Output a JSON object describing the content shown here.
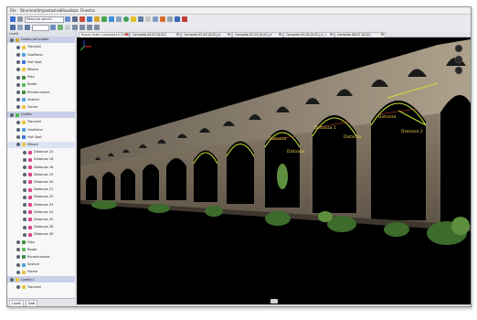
{
  "menu": [
    "File",
    "Strumenti",
    "Impostazioni",
    "Visualizza",
    "Finestra"
  ],
  "toolbar": {
    "view_mode_select": "Nessuna specie..."
  },
  "left_panel": {
    "title": "Livelli",
    "bottom_tabs": [
      "Livelli",
      "Dati"
    ],
    "tree": [
      {
        "label": "Livello principale",
        "level": 0,
        "selected": true,
        "bullet": "#d9a32b"
      },
      {
        "label": "Tracciati",
        "level": 1,
        "bullet": "#e9c43a"
      },
      {
        "label": "Geofisica",
        "level": 1,
        "bullet": "#4a9fe0"
      },
      {
        "label": "Hot Spot",
        "level": 1,
        "bullet": "#3a6fd8"
      },
      {
        "label": "Misure",
        "level": 1,
        "bullet": "#e9c43a"
      },
      {
        "label": "Foto",
        "level": 1,
        "bullet": "#3e8f3e"
      },
      {
        "label": "Radar",
        "level": 1,
        "bullet": "#5cbf5c"
      },
      {
        "label": "Ricostruzione",
        "level": 1,
        "bullet": "#3e8f3e"
      },
      {
        "label": "Sezioni",
        "level": 1,
        "bullet": "#4a9fe0"
      },
      {
        "label": "Forme",
        "level": 1,
        "bullet": "#e9c43a"
      },
      {
        "label": "Livello",
        "level": 0,
        "selected": true,
        "bullet": "#4db84d"
      },
      {
        "label": "Tracciati",
        "level": 1,
        "bullet": "#e9c43a"
      },
      {
        "label": "Geofisica",
        "level": 1,
        "bullet": "#4a9fe0"
      },
      {
        "label": "Hot Spot",
        "level": 1,
        "bullet": "#3a6fd8"
      },
      {
        "label": "Misure",
        "level": 1,
        "bullet": "#e9c43a",
        "selected": true
      },
      {
        "label": "Distanza 15",
        "level": 2,
        "bullet": "#d84a8a"
      },
      {
        "label": "Distanza 16",
        "level": 2,
        "bullet": "#d84a8a"
      },
      {
        "label": "Distanza 18",
        "level": 2,
        "bullet": "#d84a8a"
      },
      {
        "label": "Distanza 19",
        "level": 2,
        "bullet": "#d84a8a"
      },
      {
        "label": "Distanza 20",
        "level": 2,
        "bullet": "#d84a8a"
      },
      {
        "label": "Distanza 21",
        "level": 2,
        "bullet": "#d84a8a"
      },
      {
        "label": "Distanza 22",
        "level": 2,
        "bullet": "#d84a8a"
      },
      {
        "label": "Distanza 23",
        "level": 2,
        "bullet": "#d84a8a"
      },
      {
        "label": "Distanza 24",
        "level": 2,
        "bullet": "#d84a8a"
      },
      {
        "label": "Distanza 25",
        "level": 2,
        "bullet": "#d84a8a"
      },
      {
        "label": "Distanza 26",
        "level": 2,
        "bullet": "#d84a8a"
      },
      {
        "label": "Distanza 30",
        "level": 2,
        "bullet": "#d84a8a"
      },
      {
        "label": "Foto",
        "level": 1,
        "bullet": "#3e8f3e"
      },
      {
        "label": "Radar",
        "level": 1,
        "bullet": "#5cbf5c"
      },
      {
        "label": "Ricostruzione",
        "level": 1,
        "bullet": "#3e8f3e"
      },
      {
        "label": "Sezioni",
        "level": 1,
        "bullet": "#4a9fe0"
      },
      {
        "label": "Forme",
        "level": 1,
        "bullet": "#e9c43a"
      },
      {
        "label": "Livello 1",
        "level": 0,
        "selected": true,
        "bullet": "#e9c43a"
      },
      {
        "label": "Tracciati",
        "level": 1,
        "bullet": "#e9c43a"
      }
    ]
  },
  "tabs": [
    {
      "label": "Nuovo Salen Completo10-25mil",
      "active": true
    },
    {
      "label": "Campata 03-03 [0,02]",
      "active": false
    },
    {
      "label": "Campata 03-04 [0,02]_e",
      "active": false
    },
    {
      "label": "Campata 02-03 [0,02]_e",
      "active": false
    },
    {
      "label": "Campata 03-06 [0,02]_0_1",
      "active": false
    },
    {
      "label": "Campata 06-07 [0,02]",
      "active": false
    }
  ],
  "viewport": {
    "background": "#000000",
    "measure_labels": [
      "Distanza",
      "Distanza",
      "Distanza 1",
      "Distanza",
      "Distanza",
      "Distanza 2"
    ]
  }
}
